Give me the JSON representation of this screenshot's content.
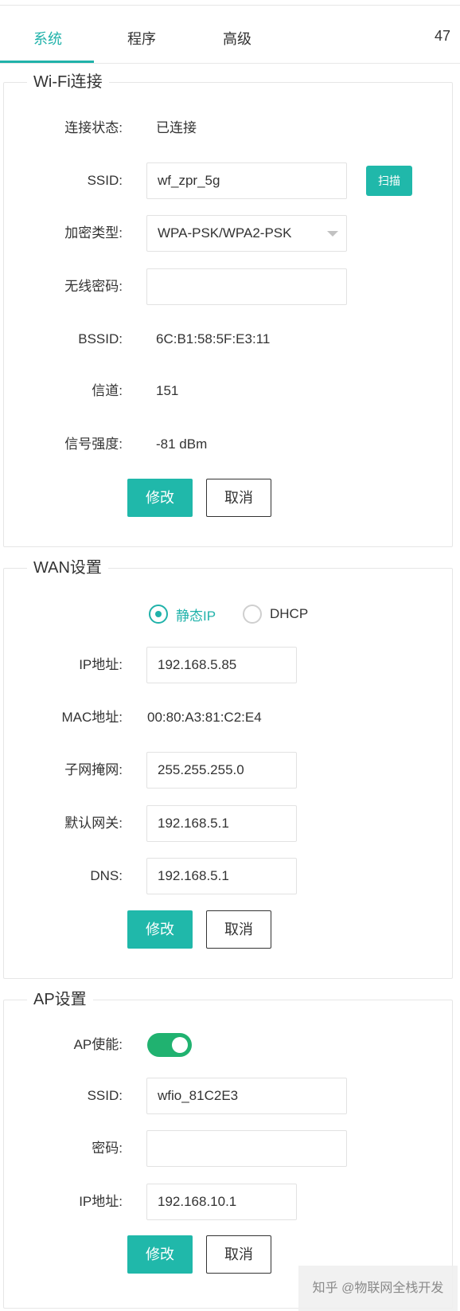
{
  "tabs": [
    {
      "label": "系统",
      "active": true
    },
    {
      "label": "程序",
      "active": false
    },
    {
      "label": "高级",
      "active": false
    }
  ],
  "tab_count": "47",
  "accent_color": "#20b2aa",
  "wifi": {
    "title": "Wi-Fi连接",
    "status_label": "连接状态:",
    "status_value": "已连接",
    "ssid_label": "SSID:",
    "ssid_value": "wf_zpr_5g",
    "scan_button": "扫描",
    "encryption_label": "加密类型:",
    "encryption_value": "WPA-PSK/WPA2-PSK",
    "password_label": "无线密码:",
    "password_value": "",
    "bssid_label": "BSSID:",
    "bssid_value": "6C:B1:58:5F:E3:11",
    "channel_label": "信道:",
    "channel_value": "151",
    "signal_label": "信号强度:",
    "signal_value": "-81 dBm",
    "submit_button": "修改",
    "cancel_button": "取消"
  },
  "wan": {
    "title": "WAN设置",
    "mode_static": "静态IP",
    "mode_dhcp": "DHCP",
    "selected_mode": "静态IP",
    "ip_label": "IP地址:",
    "ip_value": "192.168.5.85",
    "mac_label": "MAC地址:",
    "mac_value": "00:80:A3:81:C2:E4",
    "subnet_label": "子网掩网:",
    "subnet_value": "255.255.255.0",
    "gateway_label": "默认网关:",
    "gateway_value": "192.168.5.1",
    "dns_label": "DNS:",
    "dns_value": "192.168.5.1",
    "submit_button": "修改",
    "cancel_button": "取消"
  },
  "ap": {
    "title": "AP设置",
    "enable_label": "AP使能:",
    "enabled": true,
    "ssid_label": "SSID:",
    "ssid_value": "wfio_81C2E3",
    "password_label": "密码:",
    "password_value": "",
    "ip_label": "IP地址:",
    "ip_value": "192.168.10.1",
    "submit_button": "修改",
    "cancel_button": "取消"
  },
  "watermark": "知乎 @物联网全栈开发"
}
